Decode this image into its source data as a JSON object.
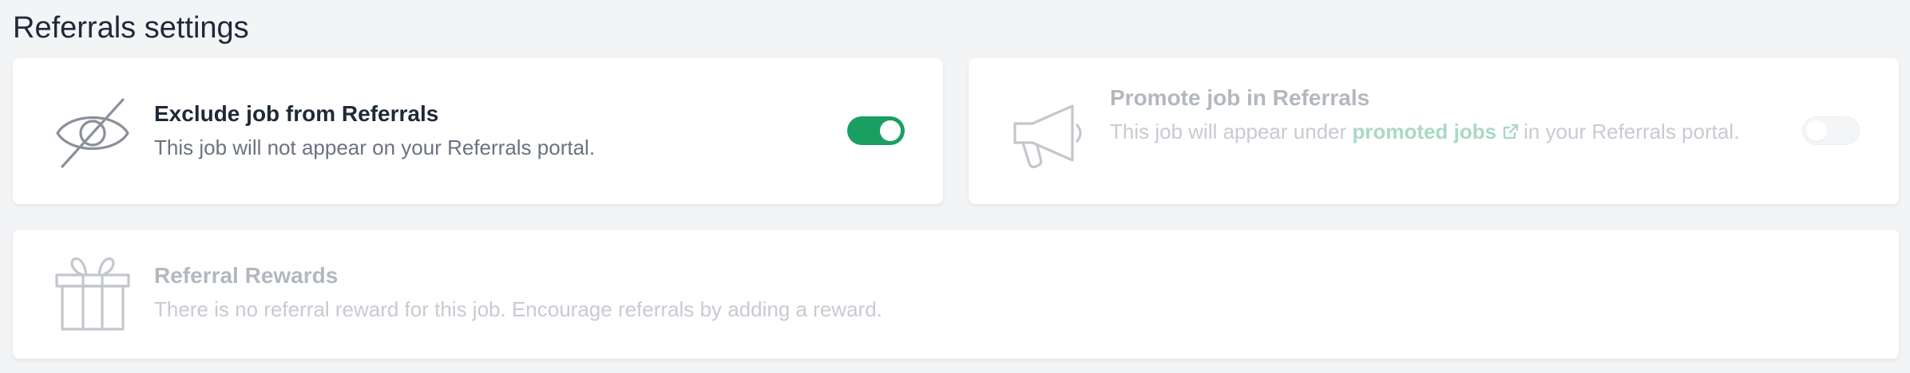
{
  "page": {
    "title": "Referrals settings"
  },
  "exclude": {
    "title": "Exclude job from Referrals",
    "description": "This job will not appear on your Referrals portal.",
    "icon": "eye-slash-icon",
    "toggle_on": true
  },
  "promote": {
    "title": "Promote job in Referrals",
    "description_before": "This job will appear under",
    "link_text": "promoted jobs",
    "description_after": "in your Referrals portal.",
    "icon": "megaphone-icon",
    "toggle_on": false,
    "disabled": true
  },
  "rewards": {
    "title": "Referral Rewards",
    "description": "There is no referral reward for this job. Encourage referrals by adding a reward.",
    "icon": "gift-icon",
    "disabled": true
  },
  "colors": {
    "toggle_on": "#1a9f63",
    "title_text": "#1f2937",
    "muted_text": "#6b7280",
    "disabled_text": "#c7cbd1",
    "link_disabled": "#a9d9c3"
  }
}
